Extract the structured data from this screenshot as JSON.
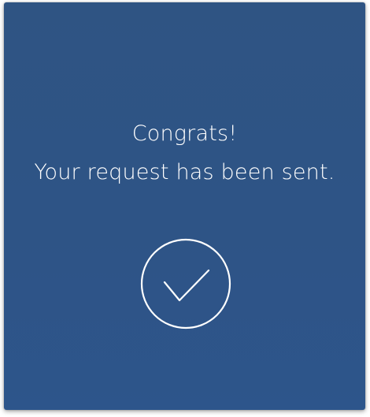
{
  "confirmation": {
    "title": "Congrats!",
    "message": "Your request has been sent."
  },
  "icons": {
    "status": "checkmark-circle-icon"
  },
  "colors": {
    "background": "#2e5486",
    "foreground": "#ffffff"
  }
}
